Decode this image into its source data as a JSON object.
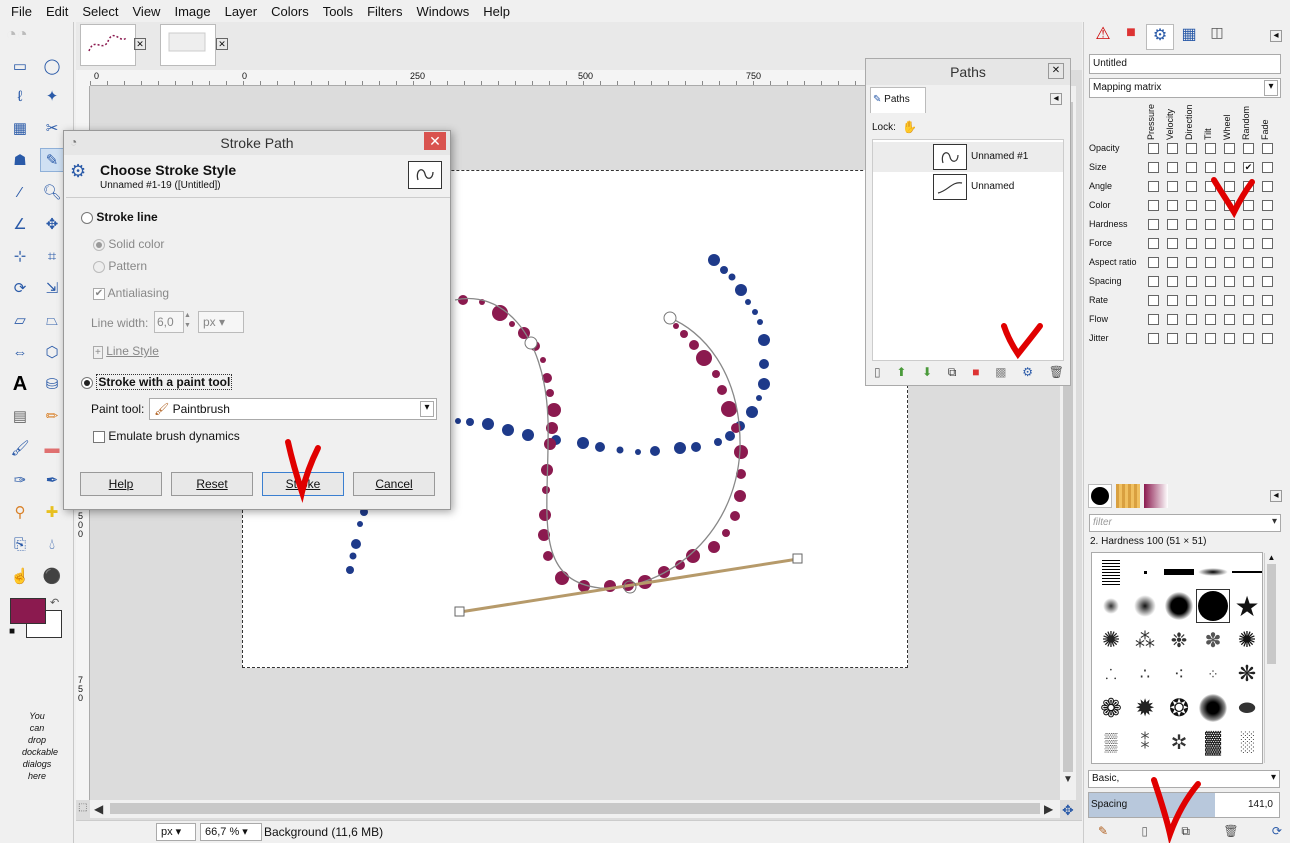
{
  "menu": [
    "File",
    "Edit",
    "Select",
    "View",
    "Image",
    "Layer",
    "Colors",
    "Tools",
    "Filters",
    "Windows",
    "Help"
  ],
  "ruler": {
    "h_ticks": [
      "0",
      "250",
      "500",
      "750"
    ],
    "v_ticks": [
      "5\n0\n0",
      "7\n5\n0"
    ],
    "origin": "0"
  },
  "toolbox": {
    "drop_hint": "You can drop dockable dialogs here"
  },
  "status": {
    "unit": "px",
    "zoom": "66,7 %",
    "layer_info": "Background (11,6 MB)"
  },
  "stroke_dialog": {
    "title": "Stroke Path",
    "heading": "Choose Stroke Style",
    "subheading": "Unnamed #1-19 ([Untitled])",
    "stroke_line": "Stroke line",
    "solid_color": "Solid color",
    "pattern": "Pattern",
    "antialiasing": "Antialiasing",
    "line_width_label": "Line width:",
    "line_width_value": "6,0",
    "line_width_unit": "px",
    "line_style": "Line Style",
    "stroke_paint": "Stroke with a paint tool",
    "paint_tool_label": "Paint tool:",
    "paint_tool_value": "Paintbrush",
    "emulate": "Emulate brush dynamics",
    "help": "Help",
    "reset": "Reset",
    "stroke": "Stroke",
    "cancel": "Cancel"
  },
  "paths_panel": {
    "title": "Paths",
    "tab": "Paths",
    "lock": "Lock:",
    "items": [
      "Unnamed #1",
      "Unnamed"
    ]
  },
  "dynamics": {
    "name": "Untitled",
    "mode": "Mapping matrix",
    "columns": [
      "Pressure",
      "Velocity",
      "Direction",
      "Tilt",
      "Wheel",
      "Random",
      "Fade"
    ],
    "rows": [
      "Opacity",
      "Size",
      "Angle",
      "Color",
      "Hardness",
      "Force",
      "Aspect ratio",
      "Spacing",
      "Rate",
      "Flow",
      "Jitter"
    ],
    "checked": [
      [
        1,
        5
      ],
      [
        2,
        5
      ]
    ]
  },
  "brushes": {
    "filter_placeholder": "filter",
    "current": "2. Hardness 100 (51 × 51)",
    "tag": "Basic,",
    "spacing_label": "Spacing",
    "spacing_value": "141,0"
  },
  "colors": {
    "fg": "#8b1a4f",
    "bg": "#ffffff",
    "accent_red": "#e00000",
    "blue_dot": "#1e3a8a",
    "magenta_dot": "#8b1a4f"
  }
}
